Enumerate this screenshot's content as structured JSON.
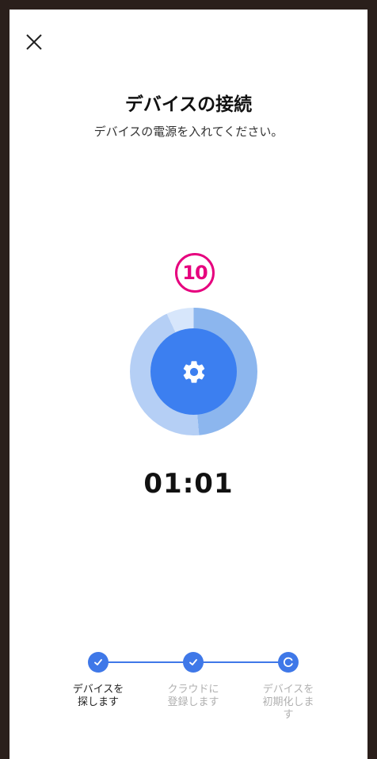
{
  "header": {
    "close_icon": "close-icon",
    "title": "デバイスの接続",
    "subtitle": "デバイスの電源を入れてください。"
  },
  "annotation": {
    "number": "10"
  },
  "status": {
    "icon": "gear-icon",
    "timer": "01:01",
    "colors": {
      "primary": "#3c7ff0",
      "ring": "#8cb6ee"
    }
  },
  "steps": [
    {
      "label": "デバイスを探します",
      "state": "done",
      "icon": "check-icon"
    },
    {
      "label": "クラウドに登録します",
      "state": "done",
      "icon": "check-icon"
    },
    {
      "label": "デバイスを初期化します",
      "state": "in-progress",
      "icon": "spinner-icon"
    }
  ]
}
